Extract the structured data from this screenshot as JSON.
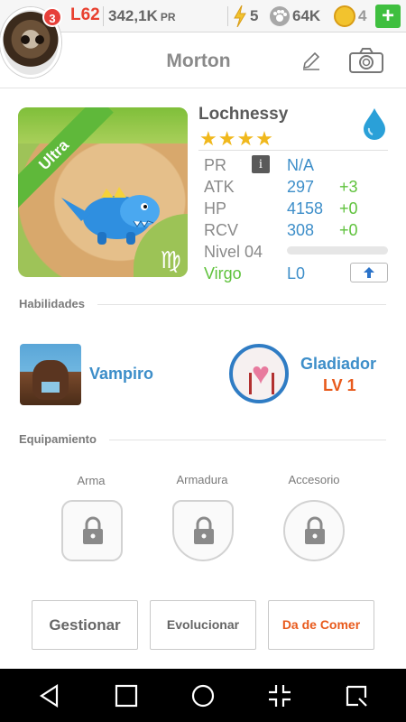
{
  "status_bar": {
    "notification_count": "3",
    "level": "L62",
    "power": "342,1K",
    "power_unit": "PR",
    "energy": "5",
    "paws": "64K",
    "coins": "4",
    "add_label": "+"
  },
  "header": {
    "title": "Morton"
  },
  "pet": {
    "rarity": "Ultra",
    "zodiac_symbol": "♍",
    "name": "Lochnessy",
    "stars": "★★★★",
    "element": "water",
    "stats": {
      "pr": {
        "label": "PR",
        "value": "N/A"
      },
      "atk": {
        "label": "ATK",
        "value": "297",
        "bonus": "+3"
      },
      "hp": {
        "label": "HP",
        "value": "4158",
        "bonus": "+0"
      },
      "rcv": {
        "label": "RCV",
        "value": "308",
        "bonus": "+0"
      }
    },
    "level_label": "Nivel 04",
    "xp_progress": 0,
    "sign": "Virgo",
    "league": "L0",
    "info_label": "i"
  },
  "skills": {
    "section_title": "Habilidades",
    "items": [
      {
        "name": "Vampiro"
      },
      {
        "name": "Gladiador",
        "level": "LV 1"
      }
    ]
  },
  "equipment": {
    "section_title": "Equipamiento",
    "slots": [
      {
        "label": "Arma"
      },
      {
        "label": "Armadura"
      },
      {
        "label": "Accesorio"
      }
    ]
  },
  "actions": {
    "manage": "Gestionar",
    "evolve": "Evolucionar",
    "feed": "Da de Comer"
  },
  "colors": {
    "accent_blue": "#3d8ec9",
    "bonus_green": "#5fc23c",
    "level_red": "#e8402f",
    "feed_orange": "#e85a1c",
    "star_gold": "#f0b81c"
  }
}
